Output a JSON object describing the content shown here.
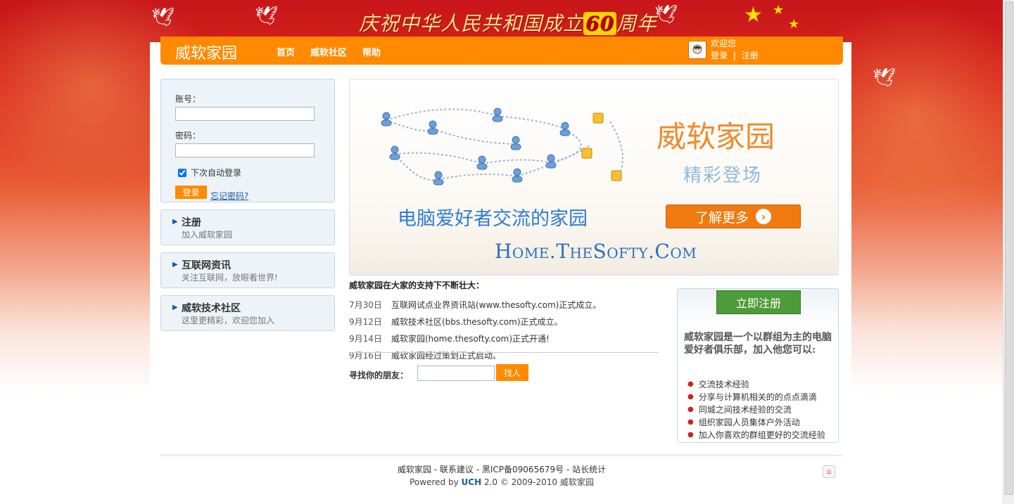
{
  "banner": {
    "text_prefix": "庆祝中华人民共和国成立",
    "text_number": "60",
    "text_suffix": "周年"
  },
  "header": {
    "logo": "威软家园",
    "nav": [
      {
        "label": "首页"
      },
      {
        "label": "威软社区"
      },
      {
        "label": "帮助"
      }
    ],
    "welcome": "欢迎您",
    "login_link": "登录",
    "separator": "|",
    "register_link": "注册"
  },
  "login": {
    "account_label": "账号：",
    "password_label": "密码：",
    "remember_label": "下次自动登录",
    "remember_checked": true,
    "submit": "登录",
    "forgot": "忘记密码?"
  },
  "sidebar": {
    "items": [
      {
        "title": "注册",
        "sub": "加入威软家园"
      },
      {
        "title": "互联网资讯",
        "sub": "关注互联网，放眼看世界!"
      },
      {
        "title": "威软技术社区",
        "sub": "这里更精彩，欢迎您加入"
      }
    ]
  },
  "hero": {
    "title": "威软家园",
    "subtitle": "精彩登场",
    "slogan": "电脑爱好者交流的家园",
    "more_button": "了解更多",
    "url": "Home.TheSofty.Com"
  },
  "news": {
    "heading": "威软家园在大家的支持下不断壮大：",
    "items": [
      {
        "date": "7月30日",
        "text": "互联网试点业界资讯站(www.thesofty.com)正式成立。"
      },
      {
        "date": "9月12日",
        "text": "威软技术社区(bbs.thesofty.com)正式成立。"
      },
      {
        "date": "9月14日",
        "text": "威软家园(home.thesofty.com)正式开通!"
      },
      {
        "date": "9月16日",
        "text": "威软家园经过策划正式启动。"
      }
    ]
  },
  "find": {
    "label": "寻找你的朋友：",
    "button": "找人",
    "value": ""
  },
  "register_panel": {
    "button": "立即注册",
    "description": "威软家园是一个以群组为主的电脑爱好者俱乐部，加入他您可以:",
    "items": [
      "交流技术经验",
      "分享与计算机相关的的点点滴滴",
      "同城之间技术经验的交流",
      "组织家园人员集体户外活动",
      "加入你喜欢的群组更好的交流经验"
    ]
  },
  "footer": {
    "site": "威软家园",
    "contact": "联系建议",
    "icp": "黑ICP备09065679号",
    "stats": "站长统计",
    "powered_prefix": "Powered by",
    "powered_brand": "UCH",
    "powered_suffix": "2.0 © 2009-2010 威软家园"
  },
  "colors": {
    "accent": "#ff8a00",
    "link": "#1a5aa8",
    "register": "#4e9b3a"
  }
}
